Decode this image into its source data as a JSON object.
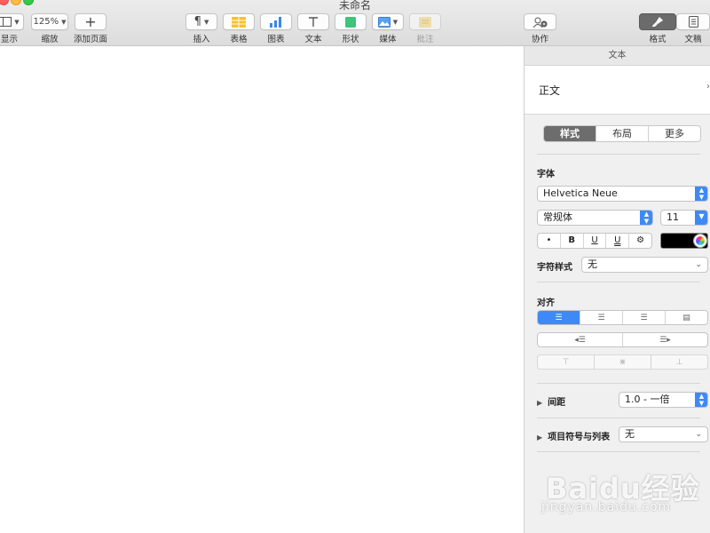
{
  "window": {
    "title": "未命名"
  },
  "toolbar": {
    "view_label": "显示",
    "zoom_value": "125%",
    "zoom_label": "缩放",
    "add_page_label": "添加页面",
    "insert_label": "插入",
    "table_label": "表格",
    "chart_label": "图表",
    "text_label": "文本",
    "shape_label": "形状",
    "media_label": "媒体",
    "comment_label": "批注",
    "collaborate_label": "协作",
    "format_label": "格式",
    "document_label": "文稿"
  },
  "inspector": {
    "tab_title": "文本",
    "paragraph_style": "正文",
    "segments": [
      "样式",
      "布局",
      "更多"
    ],
    "font_section": "字体",
    "font_family": "Helvetica Neue",
    "font_style": "常规体",
    "font_size": "11",
    "format_buttons": [
      "•",
      "B",
      "U",
      "U",
      "⚙"
    ],
    "char_style_label": "字符样式",
    "char_style_value": "无",
    "align_section": "对齐",
    "spacing_label": "间距",
    "spacing_value": "1.0 - 一倍",
    "bullets_label": "项目符号与列表",
    "bullets_value": "无"
  },
  "watermark": {
    "brand": "Baidu经验",
    "url": "jingyan.baidu.com"
  },
  "colors": {
    "accent": "#3d8af7",
    "selected_segment": "#6d6d6d",
    "text_color_swatch": "#000000"
  }
}
